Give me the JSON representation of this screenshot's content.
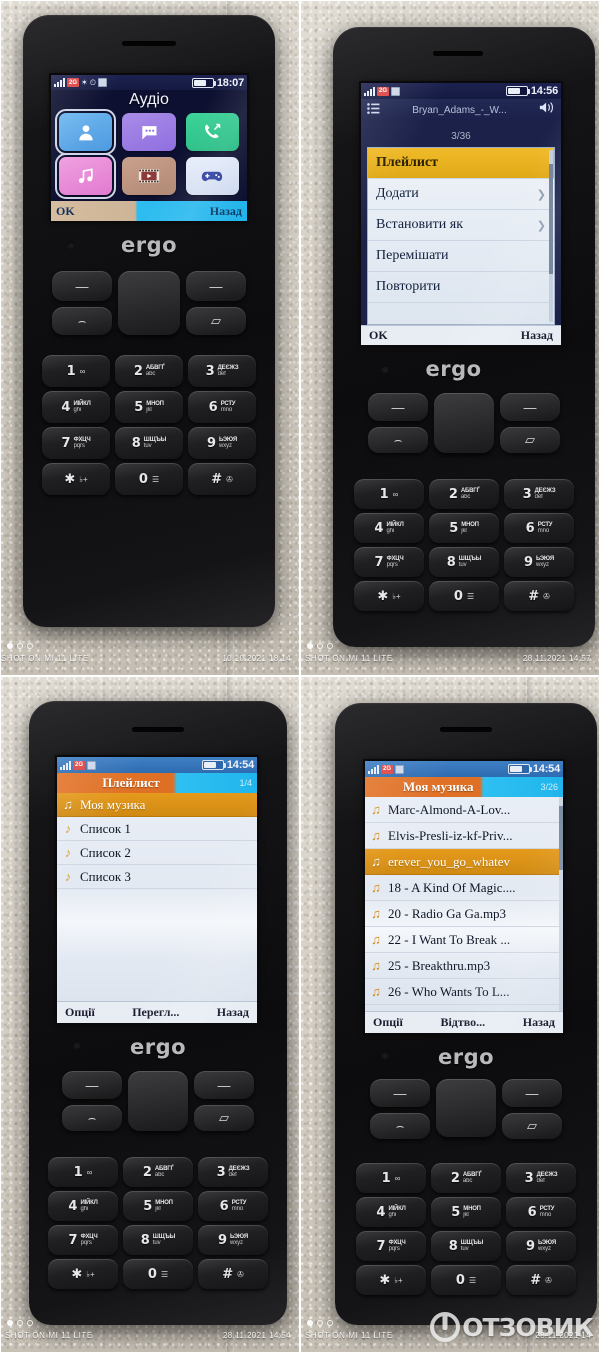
{
  "panels": [
    {
      "id": "panel-audio-menu",
      "phone_brand": "ergo",
      "status": {
        "time": "18:07"
      },
      "screen": {
        "kind": "main-menu",
        "title": "Аудіо",
        "apps": [
          {
            "name": "contacts-app",
            "color1": "#6fb8f0",
            "color2": "#4f9ae0",
            "glyph": "person"
          },
          {
            "name": "messages-app",
            "color1": "#a98ce8",
            "color2": "#8f6fe0",
            "glyph": "chat"
          },
          {
            "name": "call-log-app",
            "color1": "#3fd49a",
            "color2": "#22b87f",
            "glyph": "phone"
          },
          {
            "name": "music-app",
            "color1": "#f0a0e0",
            "color2": "#e17ad0",
            "glyph": "note",
            "selected": true
          },
          {
            "name": "video-app",
            "color1": "#c9a18d",
            "color2": "#b08872",
            "glyph": "film"
          },
          {
            "name": "games-app",
            "color1": "#e8eefb",
            "color2": "#cdd9ef",
            "glyph": "gamepad"
          },
          {
            "name": "internet-app",
            "color1": "#68e3e0",
            "color2": "#3fcbd0",
            "glyph": "globe"
          },
          {
            "name": "camera-app",
            "color1": "#f0f3e8",
            "color2": "#dfe3d2",
            "glyph": "camera"
          },
          {
            "name": "bluetooth-app",
            "color1": "#cfe0fb",
            "color2": "#a9c6f2",
            "glyph": "bt"
          },
          {
            "name": "profiles-app",
            "color1": "#b79cf2",
            "color2": "#9b7ae8",
            "glyph": "mute"
          },
          {
            "name": "calculator-app",
            "color1": "#e4e7cf",
            "color2": "#cfd4b6",
            "glyph": "calc"
          },
          {
            "name": "settings-app",
            "color1": "#8fb9f0",
            "color2": "#6a9ae2",
            "glyph": "gear"
          }
        ],
        "softkeys": {
          "left": "OK",
          "right": "Назад"
        }
      },
      "watermark": {
        "shot": "SHOT ON MI 11 LITE",
        "date": "10.10.2021 18:14"
      }
    },
    {
      "id": "panel-player-options",
      "phone_brand": "ergo",
      "status": {
        "time": "14:56"
      },
      "screen": {
        "kind": "player-options",
        "track_title": "Bryan_Adams_-_W...",
        "track_position": "3/36",
        "menu": [
          {
            "label": "Плейлист",
            "selected": true,
            "arrow": false
          },
          {
            "label": "Додати",
            "selected": false,
            "arrow": true
          },
          {
            "label": "Встановити як",
            "selected": false,
            "arrow": true
          },
          {
            "label": "Перемішати",
            "selected": false,
            "arrow": false
          },
          {
            "label": "Повторити",
            "selected": false,
            "arrow": false
          }
        ],
        "softkeys": {
          "left": "OK",
          "right": "Назад"
        }
      },
      "watermark": {
        "shot": "SHOT ON MI 11 LITE",
        "date": "28.11.2021 14:57"
      }
    },
    {
      "id": "panel-playlist",
      "phone_brand": "ergo",
      "status": {
        "time": "14:54"
      },
      "screen": {
        "kind": "list",
        "title": "Плейлист",
        "page": "1/4",
        "items": [
          {
            "label": "Моя музика",
            "selected": true
          },
          {
            "label": "Список 1",
            "selected": false
          },
          {
            "label": "Список 2",
            "selected": false
          },
          {
            "label": "Список 3",
            "selected": false
          }
        ],
        "softkeys": {
          "left": "Опції",
          "center": "Перегл...",
          "right": "Назад"
        }
      },
      "watermark": {
        "shot": "SHOT ON MI 11 LITE",
        "date": "28.11.2021 14:54"
      }
    },
    {
      "id": "panel-my-music",
      "phone_brand": "ergo",
      "status": {
        "time": "14:54"
      },
      "screen": {
        "kind": "list",
        "title": "Моя музика",
        "page": "3/26",
        "items": [
          {
            "label": "Marc-Almond-A-Lov...",
            "selected": false
          },
          {
            "label": "Elvis-Presli-iz-kf-Priv...",
            "selected": false
          },
          {
            "label": "erever_you_go_whatev",
            "selected": true
          },
          {
            "label": "18 - A Kind Of Magic....",
            "selected": false
          },
          {
            "label": "20 - Radio Ga Ga.mp3",
            "selected": false
          },
          {
            "label": "22 - I Want To Break ...",
            "selected": false
          },
          {
            "label": "25 - Breakthru.mp3",
            "selected": false
          },
          {
            "label": "26 - Who Wants To L...",
            "selected": false
          }
        ],
        "softkeys": {
          "left": "Опції",
          "center": "Відтво...",
          "right": "Назад"
        }
      },
      "watermark": {
        "shot": "SHOT ON MI 11 LITE",
        "date": "28.11.2021 14"
      },
      "site_watermark": "ОТЗОВИК"
    }
  ],
  "keypad": {
    "rows": [
      [
        {
          "big": "1",
          "cyr": "",
          "lat": "",
          "glyph": "∞"
        },
        {
          "big": "2",
          "cyr": "АБВГҐ",
          "lat": "abc",
          "glyph": ""
        },
        {
          "big": "3",
          "cyr": "ДЕЄЖЗ",
          "lat": "def",
          "glyph": ""
        }
      ],
      [
        {
          "big": "4",
          "cyr": "ИІЙКЛ",
          "lat": "ghi",
          "glyph": ""
        },
        {
          "big": "5",
          "cyr": "МНОП",
          "lat": "jkl",
          "glyph": ""
        },
        {
          "big": "6",
          "cyr": "РСТУ",
          "lat": "mno",
          "glyph": ""
        }
      ],
      [
        {
          "big": "7",
          "cyr": "ФХЦЧ",
          "lat": "pqrs",
          "glyph": ""
        },
        {
          "big": "8",
          "cyr": "ШЩЪЫ",
          "lat": "tuv",
          "glyph": ""
        },
        {
          "big": "9",
          "cyr": "ЬЭЮЯ",
          "lat": "wxyz",
          "glyph": ""
        }
      ],
      [
        {
          "big": "✱",
          "cyr": "",
          "lat": "",
          "glyph": "♭+"
        },
        {
          "big": "0",
          "cyr": "",
          "lat": "",
          "glyph": "☰"
        },
        {
          "big": "#",
          "cyr": "",
          "lat": "",
          "glyph": "✇"
        }
      ]
    ],
    "soft_left": "—",
    "soft_right": "—",
    "call_left": "⌢",
    "call_right": "▱"
  }
}
